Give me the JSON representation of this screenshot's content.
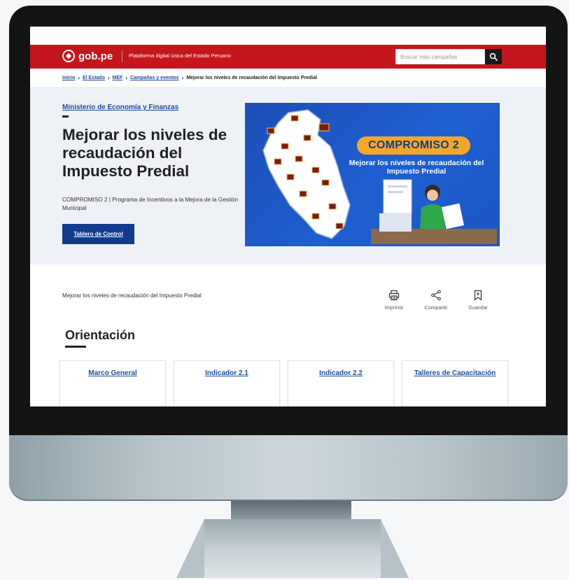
{
  "header": {
    "logo_text": "gob.pe",
    "tagline": "Plataforma digital única del Estado Peruano",
    "search_placeholder": "Buscar más campañas"
  },
  "breadcrumb": {
    "items": [
      "Inicio",
      "El Estado",
      "MEF",
      "Campañas y eventos"
    ],
    "current": "Mejorar los niveles de recaudación del Impuesto Predial"
  },
  "hero": {
    "ministry": "Ministerio de Economía y Finanzas",
    "title": "Mejorar los niveles de recaudación del Impuesto Predial",
    "subtitle": "COMPROMISO 2 | Programa de Incentivos a la Mejora de la Gestión Municipal",
    "button": "Tablero de Control"
  },
  "banner": {
    "pill": "COMPROMISO 2",
    "line": "Mejorar los niveles de recaudación del Impuesto Predial"
  },
  "content": {
    "subtitle": "Mejorar los niveles de recaudación del Impuesto Predial",
    "actions": [
      "Imprimir",
      "Compartir",
      "Guardar"
    ],
    "section_title": "Orientación",
    "cards": [
      "Marco General",
      "Indicador 2.1",
      "Indicador 2.2",
      "Talleres de Capacitación"
    ]
  },
  "colors": {
    "brand_red": "#c4161c",
    "link_blue": "#1a4fa0",
    "button_navy": "#123b8c",
    "banner_blue": "#1e5fd0",
    "banner_accent": "#f4a62a"
  }
}
